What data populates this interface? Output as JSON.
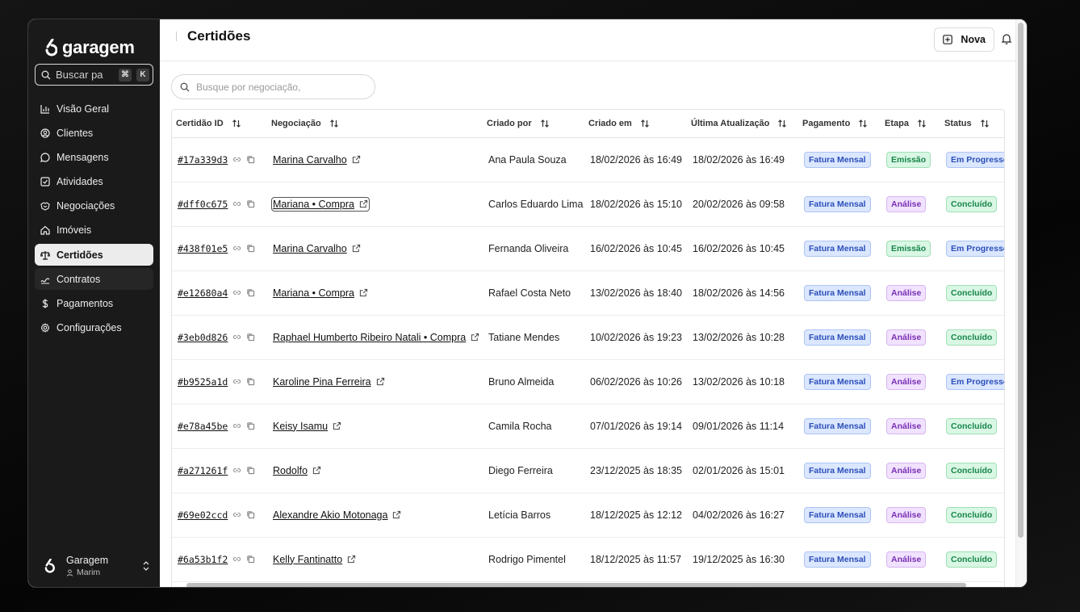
{
  "app": {
    "brand": "garagem"
  },
  "sidebar": {
    "search_placeholder": "Buscar pa",
    "kbd_cmd": "⌘",
    "kbd_k": "K",
    "items": [
      {
        "label": "Visão Geral",
        "icon": "chart-bar-icon"
      },
      {
        "label": "Clientes",
        "icon": "user-circle-icon"
      },
      {
        "label": "Mensagens",
        "icon": "message-icon"
      },
      {
        "label": "Atividades",
        "icon": "checkbox-icon"
      },
      {
        "label": "Negociações",
        "icon": "handshake-icon"
      },
      {
        "label": "Imóveis",
        "icon": "house-icon"
      },
      {
        "label": "Certidões",
        "icon": "scale-icon"
      },
      {
        "label": "Contratos",
        "icon": "contract-icon"
      },
      {
        "label": "Pagamentos",
        "icon": "dollar-icon"
      },
      {
        "label": "Configurações",
        "icon": "gear-icon"
      }
    ],
    "user": {
      "org": "Garagem",
      "name": "Marim"
    }
  },
  "header": {
    "title": "Certidões",
    "new_button": "Nova"
  },
  "filter": {
    "placeholder": "Busque por negociação,"
  },
  "table": {
    "columns": [
      "Certidão ID",
      "Negociação",
      "Criado por",
      "Criado em",
      "Última Atualização",
      "Pagamento",
      "Etapa",
      "Status"
    ],
    "rows": [
      {
        "id": "#17a339d3",
        "negociacao": "Marina Carvalho",
        "criado_por": "Ana Paula Souza",
        "criado_em": "18/02/2026 às 16:49",
        "atualizacao": "18/02/2026 às 16:49",
        "pagamento": "Fatura Mensal",
        "etapa": "Emissão",
        "status": "Em Progresso"
      },
      {
        "id": "#dff0c675",
        "negociacao": "Mariana • Compra",
        "criado_por": "Carlos Eduardo Lima",
        "criado_em": "18/02/2026 às 15:10",
        "atualizacao": "20/02/2026 às 09:58",
        "pagamento": "Fatura Mensal",
        "etapa": "Análise",
        "status": "Concluído"
      },
      {
        "id": "#438f01e5",
        "negociacao": "Marina Carvalho",
        "criado_por": "Fernanda Oliveira",
        "criado_em": "16/02/2026 às 10:45",
        "atualizacao": "16/02/2026 às 10:45",
        "pagamento": "Fatura Mensal",
        "etapa": "Emissão",
        "status": "Em Progresso"
      },
      {
        "id": "#e12680a4",
        "negociacao": "Mariana • Compra",
        "criado_por": "Rafael Costa Neto",
        "criado_em": "13/02/2026 às 18:40",
        "atualizacao": "18/02/2026 às 14:56",
        "pagamento": "Fatura Mensal",
        "etapa": "Análise",
        "status": "Concluído"
      },
      {
        "id": "#3eb0d826",
        "negociacao": "Raphael Humberto Ribeiro Natali • Compra",
        "criado_por": "Tatiane Mendes",
        "criado_em": "10/02/2026 às 19:23",
        "atualizacao": "13/02/2026 às 10:28",
        "pagamento": "Fatura Mensal",
        "etapa": "Análise",
        "status": "Concluído"
      },
      {
        "id": "#b9525a1d",
        "negociacao": "Karoline Pina Ferreira",
        "criado_por": "Bruno Almeida",
        "criado_em": "06/02/2026 às 10:26",
        "atualizacao": "13/02/2026 às 10:18",
        "pagamento": "Fatura Mensal",
        "etapa": "Análise",
        "status": "Em Progresso"
      },
      {
        "id": "#e78a45be",
        "negociacao": "Keisy Isamu",
        "criado_por": "Camila Rocha",
        "criado_em": "07/01/2026 às 19:14",
        "atualizacao": "09/01/2026 às 11:14",
        "pagamento": "Fatura Mensal",
        "etapa": "Análise",
        "status": "Concluído"
      },
      {
        "id": "#a271261f",
        "negociacao": "Rodolfo",
        "criado_por": "Diego Ferreira",
        "criado_em": "23/12/2025 às 18:35",
        "atualizacao": "02/01/2026 às 15:01",
        "pagamento": "Fatura Mensal",
        "etapa": "Análise",
        "status": "Concluído"
      },
      {
        "id": "#69e02ccd",
        "negociacao": "Alexandre Akio Motonaga",
        "criado_por": "Letícia Barros",
        "criado_em": "18/12/2025 às 12:12",
        "atualizacao": "04/02/2026 às 16:27",
        "pagamento": "Fatura Mensal",
        "etapa": "Análise",
        "status": "Concluído"
      },
      {
        "id": "#6a53b1f2",
        "negociacao": "Kelly Fantinatto",
        "criado_por": "Rodrigo Pimentel",
        "criado_em": "18/12/2025 às 11:57",
        "atualizacao": "19/12/2025 às 16:30",
        "pagamento": "Fatura Mensal",
        "etapa": "Análise",
        "status": "Concluído"
      }
    ]
  }
}
